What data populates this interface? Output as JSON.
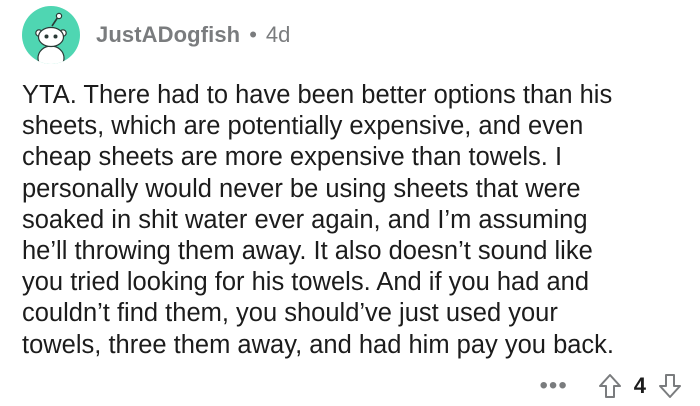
{
  "comment": {
    "username": "JustADogfish",
    "separator": "•",
    "age": "4d",
    "body_lines": [
      "YTA. There had to have been better options than his",
      "sheets, which are potentially expensive, and even",
      "cheap sheets are more expensive than towels. I",
      "personally would never be using sheets that were",
      "soaked in shit water ever again, and I’m assuming",
      "he’ll throwing them away. It also doesn’t sound like",
      "you tried looking for his towels. And if you had and",
      "couldn’t find them, you should’ve just used your",
      "towels, three them away, and had him pay you back."
    ],
    "more_label": "•••",
    "score": "4"
  },
  "colors": {
    "avatar_bg": "#4fd6b2",
    "meta_text": "#7a7c7e",
    "body_text": "#1c1c1c"
  },
  "icons": {
    "avatar": "snoo-avatar-icon",
    "upvote": "upvote-arrow-icon",
    "downvote": "downvote-arrow-icon",
    "more": "more-options-icon"
  }
}
